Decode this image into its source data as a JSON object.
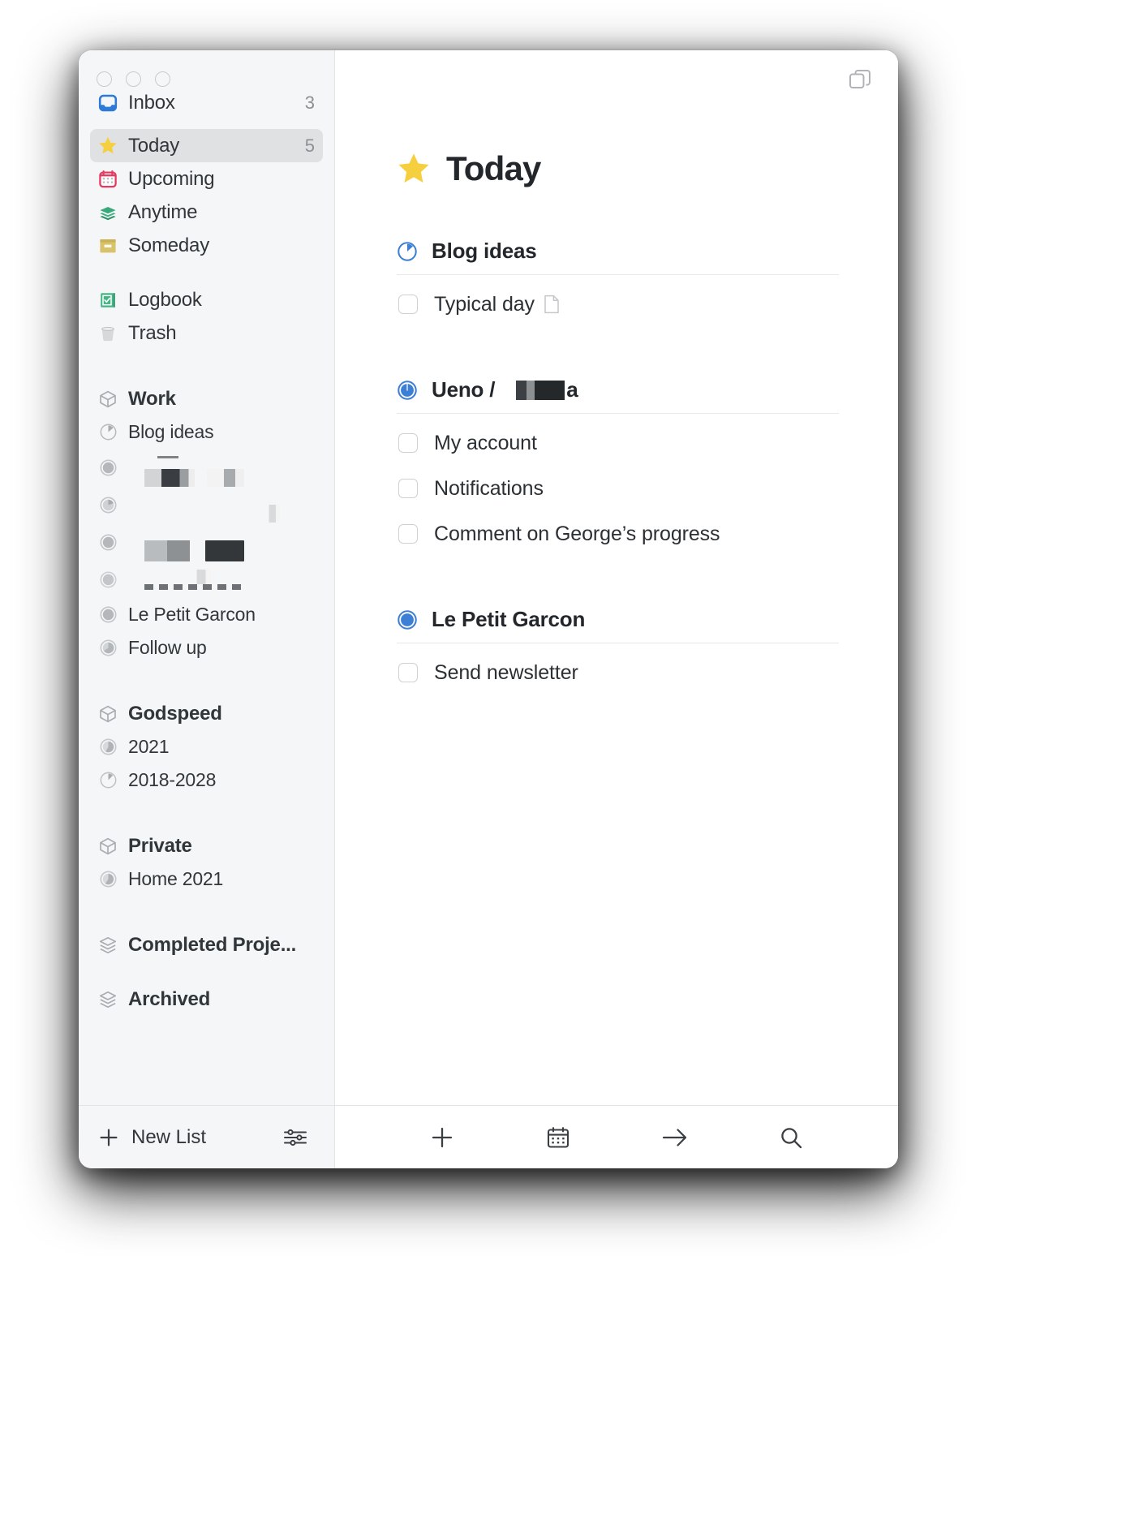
{
  "window": {
    "traffic_lights": [
      "close",
      "minimize",
      "zoom"
    ],
    "top_right_icon": "copy-window-icon"
  },
  "sidebar": {
    "nav": [
      {
        "id": "inbox",
        "label": "Inbox",
        "icon": "inbox-icon",
        "count": "3",
        "selected": false
      },
      {
        "id": "today",
        "label": "Today",
        "icon": "star-icon",
        "count": "5",
        "selected": true
      },
      {
        "id": "upcoming",
        "label": "Upcoming",
        "icon": "calendar-icon",
        "count": "",
        "selected": false
      },
      {
        "id": "anytime",
        "label": "Anytime",
        "icon": "layers-icon",
        "count": "",
        "selected": false
      },
      {
        "id": "someday",
        "label": "Someday",
        "icon": "crate-icon",
        "count": "",
        "selected": false
      }
    ],
    "nav2": [
      {
        "id": "logbook",
        "label": "Logbook",
        "icon": "logbook-icon",
        "count": ""
      },
      {
        "id": "trash",
        "label": "Trash",
        "icon": "trash-icon",
        "count": ""
      }
    ],
    "areas": [
      {
        "id": "work",
        "label": "Work",
        "projects": [
          {
            "id": "blog-ideas",
            "label": "Blog ideas",
            "progress": 0.12,
            "redacted": false
          },
          {
            "id": "redacted-1",
            "label": "",
            "progress": 1.0,
            "redacted": true,
            "style": "a"
          },
          {
            "id": "redacted-2",
            "label": "",
            "progress": 0.5,
            "redacted": true,
            "style": "b"
          },
          {
            "id": "redacted-3",
            "label": "",
            "progress": 1.0,
            "redacted": true,
            "style": "c"
          },
          {
            "id": "redacted-4",
            "label": "",
            "progress": 1.0,
            "redacted": true,
            "style": "d"
          },
          {
            "id": "le-petit-garcon",
            "label": "Le Petit Garcon",
            "progress": 1.0,
            "redacted": false
          },
          {
            "id": "follow-up",
            "label": "Follow up",
            "progress": 0.55,
            "redacted": false
          }
        ]
      },
      {
        "id": "godspeed",
        "label": "Godspeed",
        "projects": [
          {
            "id": "y2021",
            "label": "2021",
            "progress": 0.6,
            "redacted": false
          },
          {
            "id": "y2018-2028",
            "label": "2018-2028",
            "progress": 0.14,
            "redacted": false
          }
        ]
      },
      {
        "id": "private",
        "label": "Private",
        "projects": [
          {
            "id": "home-2021",
            "label": "Home 2021",
            "progress": 0.62,
            "redacted": false
          }
        ]
      },
      {
        "id": "completed-projects",
        "label": "Completed Proje...",
        "projects": []
      },
      {
        "id": "archived",
        "label": "Archived",
        "projects": []
      }
    ],
    "footer": {
      "new_list_label": "New List",
      "new_list_icon": "plus-icon",
      "settings_icon": "sliders-icon"
    }
  },
  "main": {
    "page_title": "Today",
    "page_title_icon": "star-icon",
    "sections": [
      {
        "id": "blog-ideas",
        "title": "Blog ideas",
        "title_redacted": "",
        "progress": 0.12,
        "todos": [
          {
            "id": "typical-day",
            "label": "Typical day",
            "note_icon": "note-icon",
            "checked": false
          }
        ]
      },
      {
        "id": "ueno",
        "title": "Ueno /",
        "title_redacted": "a",
        "progress": 1.0,
        "todos": [
          {
            "id": "my-account",
            "label": "My account",
            "note_icon": "",
            "checked": false
          },
          {
            "id": "notifications",
            "label": "Notifications",
            "note_icon": "",
            "checked": false
          },
          {
            "id": "comment-george",
            "label": "Comment on George’s progress",
            "note_icon": "",
            "checked": false
          }
        ]
      },
      {
        "id": "le-petit-garcon",
        "title": "Le Petit Garcon",
        "title_redacted": "",
        "progress": 1.0,
        "todos": [
          {
            "id": "send-newsletter",
            "label": "Send newsletter",
            "note_icon": "",
            "checked": false
          }
        ]
      }
    ],
    "footer_buttons": [
      {
        "id": "new-todo",
        "icon": "plus-icon"
      },
      {
        "id": "when",
        "icon": "calendar-icon"
      },
      {
        "id": "move",
        "icon": "arrow-right-icon"
      },
      {
        "id": "search",
        "icon": "search-icon"
      }
    ]
  },
  "colors": {
    "accent_blue": "#3e7fd6",
    "star_yellow": "#f6cf3f",
    "sidebar_bg": "#f5f6f7",
    "selected_bg": "#e0e1e3",
    "text": "#31363a",
    "muted": "#8b9096"
  }
}
